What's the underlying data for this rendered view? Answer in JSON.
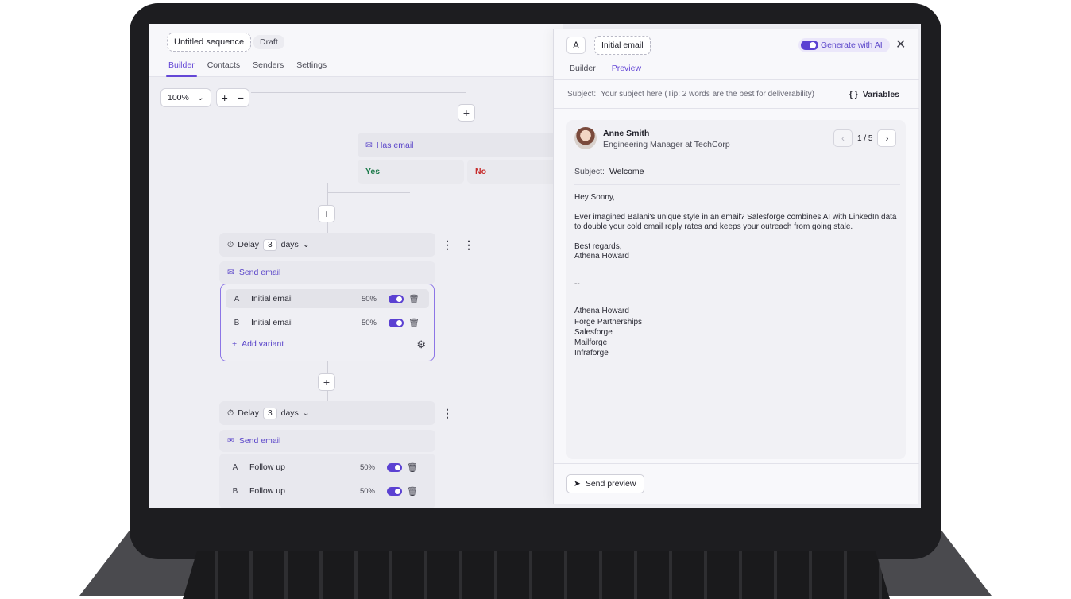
{
  "sequence": {
    "name": "Untitled sequence",
    "status": "Draft"
  },
  "tabs": [
    "Builder",
    "Contacts",
    "Senders",
    "Settings"
  ],
  "zoom": {
    "level": "100%",
    "plus": "+",
    "minus": "−"
  },
  "condition": {
    "label": "Has email",
    "yes": "Yes",
    "no": "No"
  },
  "step1": {
    "delay_prefix": "Delay",
    "delay_value": "3",
    "delay_unit": "days",
    "send_email": "Send email",
    "variants": [
      {
        "letter": "A",
        "name": "Initial email",
        "weight": "50%"
      },
      {
        "letter": "B",
        "name": "Initial email",
        "weight": "50%"
      }
    ],
    "add_variant": "Add variant"
  },
  "step2": {
    "delay_prefix": "Delay",
    "delay_value": "3",
    "delay_unit": "days",
    "send_email": "Send email",
    "variants": [
      {
        "letter": "A",
        "name": "Follow up",
        "weight": "50%"
      },
      {
        "letter": "B",
        "name": "Follow up",
        "weight": "50%"
      }
    ]
  },
  "panel": {
    "letter": "A",
    "name": "Initial email",
    "generate": "Generate with AI",
    "tabs": [
      "Builder",
      "Preview"
    ],
    "subject_label": "Subject:",
    "subject_placeholder": "Your subject here (Tip: 2 words are the best for deliverability)",
    "variables": "Variables",
    "contact": {
      "name": "Anne Smith",
      "role": "Engineering Manager at TechCorp"
    },
    "pager": "1 / 5",
    "email_subject_label": "Subject:",
    "email_subject": "Welcome",
    "greeting": "Hey Sonny,",
    "body": "Ever imagined Balani's unique style in an email? Salesforge combines AI with LinkedIn data to double your cold email reply rates and keeps your outreach from going stale.",
    "signoff1": "Best regards,",
    "signoff2": "Athena Howard",
    "separator": "--",
    "sig": [
      "Athena Howard",
      "Forge Partnerships",
      "Salesforge",
      "Mailforge",
      "Infraforge"
    ],
    "send_preview": "Send preview"
  },
  "colors": {
    "accent": "#6447d6",
    "yes": "#1c7a4a",
    "no": "#c62b2b"
  }
}
